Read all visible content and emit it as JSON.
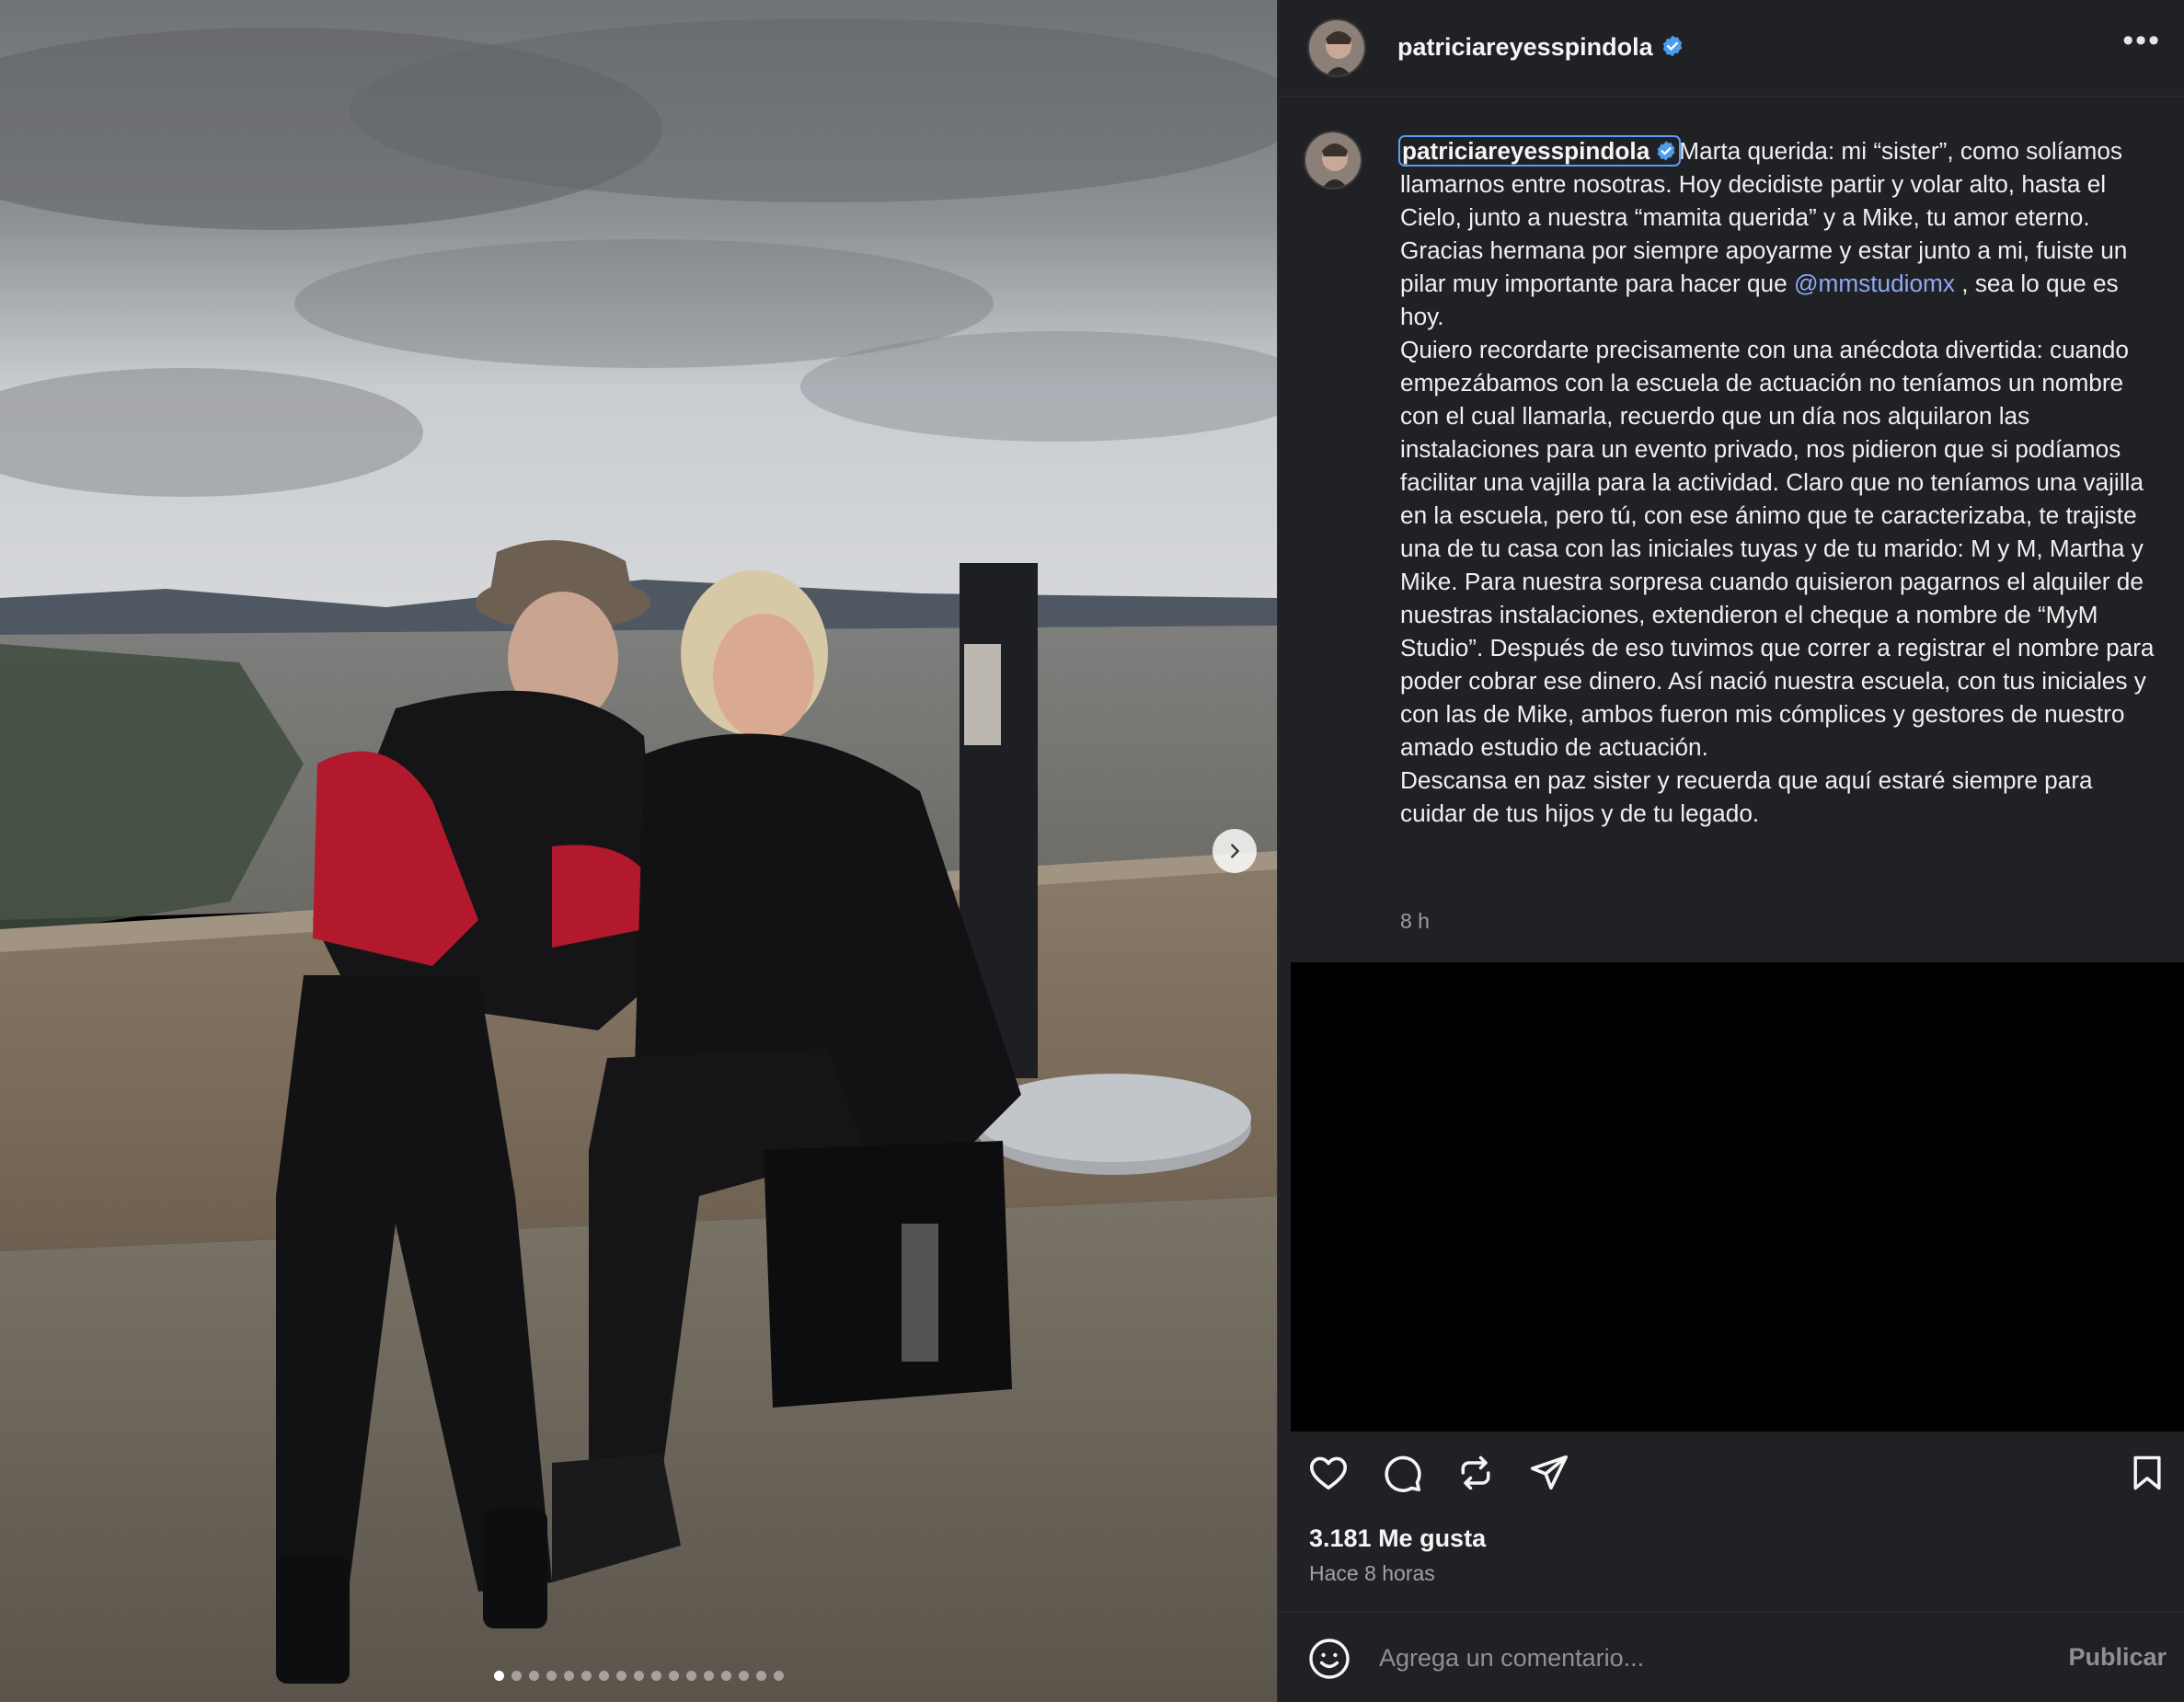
{
  "post": {
    "username": "patriciareyesspindola",
    "caption_parts": {
      "p1": "Marta querida: mi “sister”, como solíamos llamarnos entre nosotras. Hoy decidiste partir y volar alto, hasta el Cielo, junto a nuestra “mamita querida” y a Mike, tu amor eterno.",
      "p2a": "Gracias hermana por siempre apoyarme y estar junto a mi, fuiste un pilar muy importante para hacer que",
      "mention": "@mmstudiomx",
      "p2b": ", sea lo que es hoy.",
      "p3": "Quiero recordarte precisamente con una anécdota divertida: cuando empezábamos con la escuela de actuación no teníamos un nombre con el cual llamarla, recuerdo que un día nos alquilaron las instalaciones para un evento privado, nos pidieron que si podíamos facilitar una vajilla para la actividad. Claro que no teníamos una vajilla en la escuela, pero tú, con ese ánimo que te caracterizaba, te trajiste una de tu casa con las iniciales tuyas y de tu marido: M y M, Martha y Mike. Para nuestra sorpresa cuando quisieron pagarnos el alquiler de nuestras instalaciones, extendieron el cheque a nombre de “MyM Studio”. Después de eso tuvimos que correr a registrar el nombre para poder cobrar ese dinero. Así nació nuestra escuela, con tus iniciales y con las de Mike, ambos fueron mis cómplices y gestores de nuestro amado estudio de actuación.",
      "p4": "Descansa en paz sister y recuerda que aquí estaré siempre para cuidar de tus hijos y de tu legado."
    },
    "caption_time": "8 h",
    "likes": "3.181 Me gusta",
    "time_ago": "Hace 8 horas",
    "more_label": "•••",
    "carousel_count": 17,
    "carousel_active": 1
  },
  "comment": {
    "placeholder": "Agrega un comentario...",
    "publish_label": "Publicar"
  },
  "icons": {
    "verified": "verified-badge-icon",
    "like": "heart-icon",
    "comment": "comment-bubble-icon",
    "repost": "repost-icon",
    "share": "share-paper-plane-icon",
    "save": "bookmark-icon",
    "emoji": "emoji-smile-icon",
    "next": "chevron-right-icon"
  },
  "colors": {
    "panel_bg": "#1f2125",
    "verified_blue": "#4c9cf0",
    "mention": "#8ea9f5"
  }
}
